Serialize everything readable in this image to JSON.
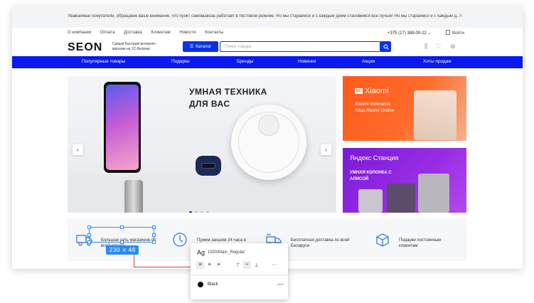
{
  "notice": {
    "text": "Уважаемые покупатели, обращаем ваше внимание, что пункт самовывоза работает в тестовом режиме. Но мы стараемся и с каждым днем становимся все лучше! Но мы стараемся и с каждым д...",
    "close": "×"
  },
  "header": {
    "links": [
      "О компании",
      "Оплата",
      "Доставка",
      "Клиентам",
      "Новости",
      "Контакты"
    ],
    "phone": "+375 (17) 388-00-22 ⌄",
    "login": "Войти",
    "logo": "SEON",
    "tagline": "Самый быстрый интернет-магазин на 1С-Битрикс",
    "catalog": "Каталог",
    "search_placeholder": "Поиск товара",
    "icons": [
      "compare-icon",
      "heart-icon",
      "cart-icon"
    ]
  },
  "nav": {
    "items": [
      "Популярные товары",
      "Подарки",
      "Бренды",
      "Новинки",
      "Акции",
      "Хиты продаж"
    ]
  },
  "banner": {
    "title_line1": "УМНАЯ ТЕХНИКА",
    "title_line2": "ДЛЯ ВАС",
    "prev": "‹",
    "next": "›",
    "active_slide": 1,
    "slide_count": 4
  },
  "promo_xiaomi": {
    "logo_mark": "mi",
    "brand": "Xiaomi",
    "line1": "Xiaomi Indonesia",
    "line2": "Situs Resmi Online"
  },
  "promo_yandex": {
    "brand": "Яндекс Станция",
    "line1": "УМНАЯ КОЛОНКА С",
    "line2": "АЛИСОЙ"
  },
  "features": [
    {
      "text": "Большая сеть магазинов по всей стране",
      "icon": "delivery-truck-icon"
    },
    {
      "text": "Прием заказов 24 часа в сутки",
      "icon": "clock-icon"
    },
    {
      "text": "Бесплатная доставка по всей Беларуси",
      "icon": "shipping-icon"
    },
    {
      "text": "Подарки постоянным клиентам",
      "icon": "gift-box-icon"
    }
  ],
  "design_overlay": {
    "size_badge": "230 × 48",
    "ag": "Ag",
    "style_name": "1920/Main_Regular",
    "align_buttons": [
      "≡",
      "≡",
      "≡",
      "⊤",
      "÷",
      "⊥",
      "···"
    ],
    "color_name": "Black",
    "remove": "—"
  },
  "colors": {
    "brand_blue": "#0a19f0",
    "xiaomi_orange": "#ff5a1a",
    "yandex_purple": "#7a19d6",
    "selection_blue": "#2b8cf5",
    "measure_red": "#e03a3a"
  }
}
